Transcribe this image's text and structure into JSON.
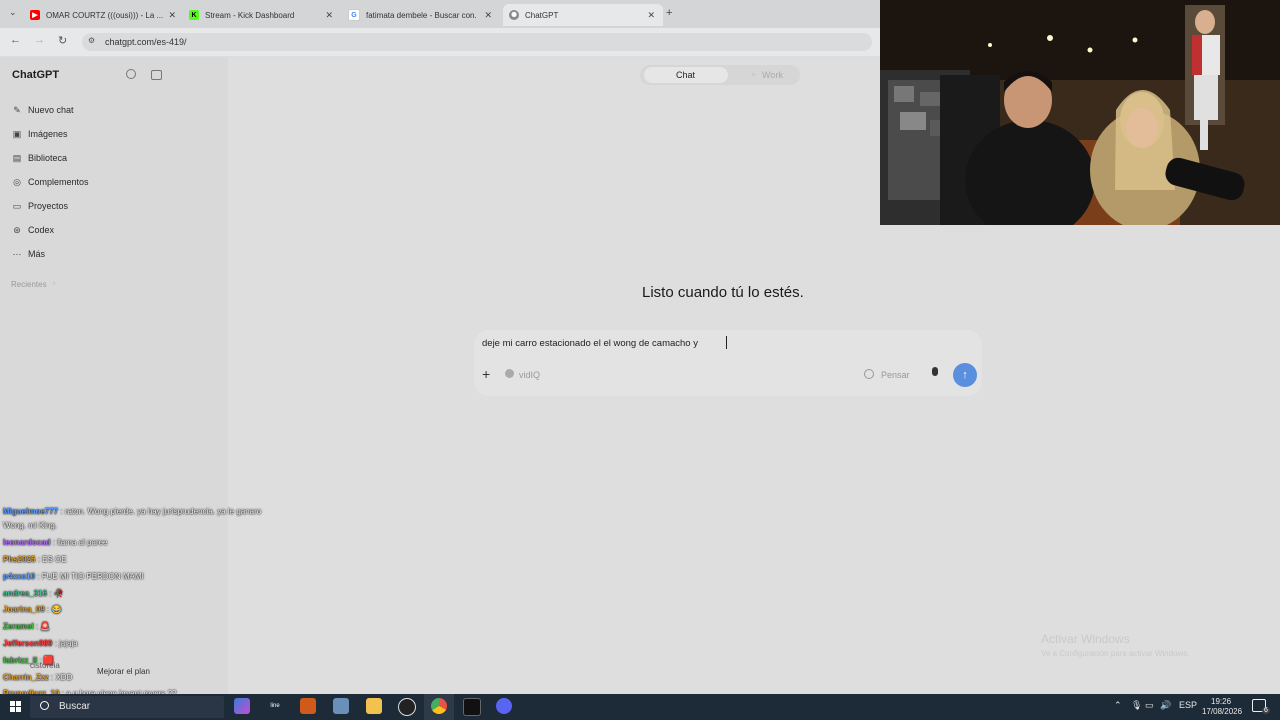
{
  "browser": {
    "tabs": [
      {
        "title": "OMAR COURTZ (((ousi))) - La ...",
        "icon": "youtube-icon",
        "color": "#ff0000"
      },
      {
        "title": "Stream - Kick Dashboard",
        "icon": "kick-icon",
        "color": "#53fc18"
      },
      {
        "title": "fatimata dembele - Buscar con...",
        "icon": "google-icon",
        "color": "#4285f4"
      },
      {
        "title": "ChatGPT",
        "icon": "chatgpt-icon",
        "color": "#888888"
      }
    ],
    "url": "chatgpt.com/es-419/"
  },
  "sidebar": {
    "app_title": "ChatGPT",
    "items": [
      {
        "label": "Nuevo chat",
        "icon": "edit-icon"
      },
      {
        "label": "Imágenes",
        "icon": "image-icon"
      },
      {
        "label": "Biblioteca",
        "icon": "library-icon"
      },
      {
        "label": "Complementos",
        "icon": "plugins-icon"
      },
      {
        "label": "Proyectos",
        "icon": "folder-icon"
      },
      {
        "label": "Codex",
        "icon": "codex-icon"
      },
      {
        "label": "Más",
        "icon": "more-icon"
      }
    ],
    "recent_label": "Recientes",
    "upgrade_label": "Mejorar el plan"
  },
  "header": {
    "mode_chat": "Chat",
    "mode_work": "Work"
  },
  "main": {
    "greeting": "Listo cuando tú lo estés.",
    "input_value": "deje mi carro estacionado el el wong de camacho y",
    "tool_chip": "vidIQ",
    "think_label": "Pensar"
  },
  "watermark": {
    "line1": "Activar Windows",
    "line2": "Ve a Configuración para activar Windows."
  },
  "chat_overlay": [
    {
      "user": "Miguelmoe777",
      "color": "#5b9cff",
      "text": "raton. Wong pierde. ya hay jurisprudencia. ya le ganaro"
    },
    {
      "user": "",
      "color": "#ffffff",
      "text": "Wong. mi King."
    },
    {
      "user": "leonardocad",
      "color": "#b26bff",
      "text": "llama al paree"
    },
    {
      "user": "Phs2025",
      "color": "#e0a030",
      "text": "ES OE"
    },
    {
      "user": "p4xxo10",
      "color": "#5b9cff",
      "text": "FUE MI TIO PERDON MAMI"
    },
    {
      "user": "andrea_316",
      "color": "#40c090",
      "text": "🥀"
    },
    {
      "user": "Joarina_09",
      "color": "#e0a030",
      "text": "😂"
    },
    {
      "user": "Zeramel",
      "color": "#40c040",
      "text": "🚨"
    },
    {
      "user": "Jefferson989",
      "color": "#ff4040",
      "text": "jajaja"
    },
    {
      "user": "fabrizz_ll",
      "color": "#40c040",
      "text": "🟥"
    },
    {
      "user": "Charrin_Zzz",
      "color": "#e0a030",
      "text": "XDD"
    },
    {
      "user": "Brunodiazz_10",
      "color": "#e0a030",
      "text": "a q hora viene bryant myers ??"
    }
  ],
  "chat_fragment": "cistoreia",
  "taskbar": {
    "search_placeholder": "Buscar",
    "lang": "ESP",
    "time": "19:26",
    "date": "17/08/2026",
    "notifications": "6"
  }
}
